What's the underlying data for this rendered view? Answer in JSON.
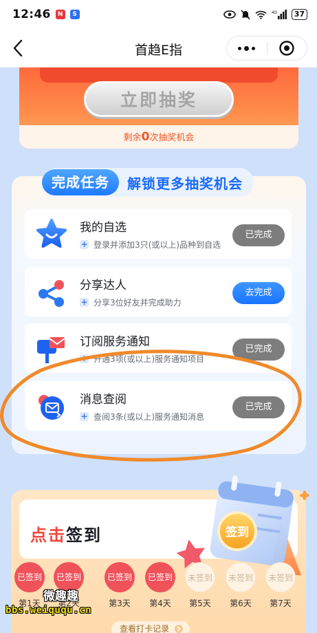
{
  "status_bar": {
    "time": "12:46",
    "battery": "37",
    "network": "4G"
  },
  "nav": {
    "title": "首趋E指"
  },
  "lottery": {
    "draw_button_label": "立即抽奖",
    "remaining_prefix": "剩余",
    "remaining_count": "0",
    "remaining_suffix": "次抽奖机会"
  },
  "tasks": {
    "header_pill": "完成任务",
    "header_text": "解锁更多抽奖机会",
    "items": [
      {
        "title": "我的自选",
        "desc": "登录并添加3只(或以上)品种到自选",
        "button": "已完成",
        "status": "done",
        "icon": "star-smile-icon"
      },
      {
        "title": "分享达人",
        "desc": "分享3位好友并完成助力",
        "button": "去完成",
        "status": "todo",
        "icon": "share-icon"
      },
      {
        "title": "订阅服务通知",
        "desc": "开通3项(或以上)服务通知项目",
        "button": "已完成",
        "status": "done",
        "icon": "mailbox-icon"
      },
      {
        "title": "消息查阅",
        "desc": "查阅3条(或以上)服务通知消息",
        "button": "已完成",
        "status": "done",
        "icon": "message-envelope-icon"
      }
    ]
  },
  "signin": {
    "title_accent": "点击",
    "title_rest": "签到",
    "badge_text": "签到",
    "days": [
      {
        "status": "已签到",
        "label": "第1天"
      },
      {
        "status": "已签到",
        "label": "第2天"
      },
      {
        "status": "已签到",
        "label": "第3天"
      },
      {
        "status": "已签到",
        "label": "第4天"
      },
      {
        "status": "未签到",
        "label": "第5天"
      },
      {
        "status": "未签到",
        "label": "第6天"
      },
      {
        "status": "未签到",
        "label": "第7天"
      }
    ],
    "record_link": "查看打卡记录"
  },
  "watermark": {
    "cn": "微趣趣",
    "url": "bbs.weiququ.cn"
  },
  "colors": {
    "primary_blue": "#1f7aff",
    "accent_red": "#f0473b",
    "done_gray": "#7d7d7d",
    "annotation_orange": "#f08a2a"
  }
}
